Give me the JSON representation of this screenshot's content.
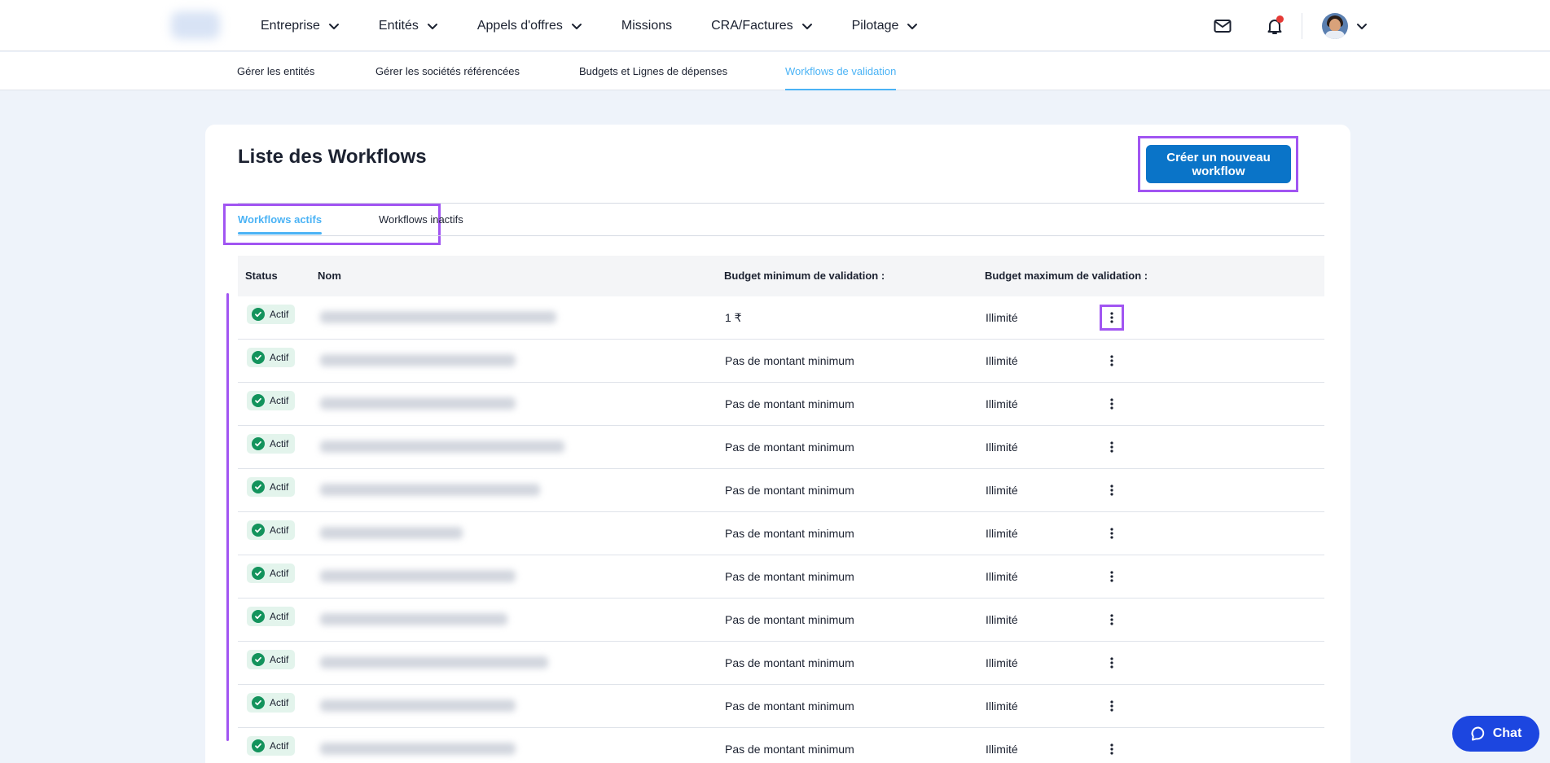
{
  "header": {
    "nav": [
      {
        "label": "Entreprise",
        "has_dropdown": true
      },
      {
        "label": "Entités",
        "has_dropdown": true
      },
      {
        "label": "Appels d'offres",
        "has_dropdown": true
      },
      {
        "label": "Missions",
        "has_dropdown": false
      },
      {
        "label": "CRA/Factures",
        "has_dropdown": true
      },
      {
        "label": "Pilotage",
        "has_dropdown": true
      }
    ],
    "icons": [
      "mail-icon",
      "bell-icon",
      "avatar",
      "chevron-down-icon"
    ]
  },
  "subnav": {
    "items": [
      {
        "label": "Gérer les entités",
        "active": false
      },
      {
        "label": "Gérer les sociétés référencées",
        "active": false
      },
      {
        "label": "Budgets et Lignes de dépenses",
        "active": false
      },
      {
        "label": "Workflows de validation",
        "active": true
      }
    ]
  },
  "page": {
    "title": "Liste des Workflows",
    "create_button": "Créer un nouveau workflow"
  },
  "tabs": [
    {
      "label": "Workflows actifs",
      "active": true
    },
    {
      "label": "Workflows inactifs",
      "active": false
    }
  ],
  "table": {
    "columns": {
      "status": "Status",
      "name": "Nom",
      "min_budget": "Budget minimum de validation :",
      "max_budget": "Budget maximum de validation :"
    },
    "rows": [
      {
        "status": "Actif",
        "min": "1 ₹",
        "max": "Illimité"
      },
      {
        "status": "Actif",
        "min": "Pas de montant minimum",
        "max": "Illimité"
      },
      {
        "status": "Actif",
        "min": "Pas de montant minimum",
        "max": "Illimité"
      },
      {
        "status": "Actif",
        "min": "Pas de montant minimum",
        "max": "Illimité"
      },
      {
        "status": "Actif",
        "min": "Pas de montant minimum",
        "max": "Illimité"
      },
      {
        "status": "Actif",
        "min": "Pas de montant minimum",
        "max": "Illimité"
      },
      {
        "status": "Actif",
        "min": "Pas de montant minimum",
        "max": "Illimité"
      },
      {
        "status": "Actif",
        "min": "Pas de montant minimum",
        "max": "Illimité"
      },
      {
        "status": "Actif",
        "min": "Pas de montant minimum",
        "max": "Illimité"
      },
      {
        "status": "Actif",
        "min": "Pas de montant minimum",
        "max": "Illimité"
      },
      {
        "status": "Actif",
        "min": "Pas de montant minimum",
        "max": "Illimité"
      }
    ]
  },
  "chat": {
    "label": "Chat"
  },
  "colors": {
    "accent": "#4bb3f5",
    "primary_button": "#0a74c8",
    "highlight_box": "#a155f2",
    "status_green": "#13935c",
    "chat_blue": "#1c46e0"
  }
}
